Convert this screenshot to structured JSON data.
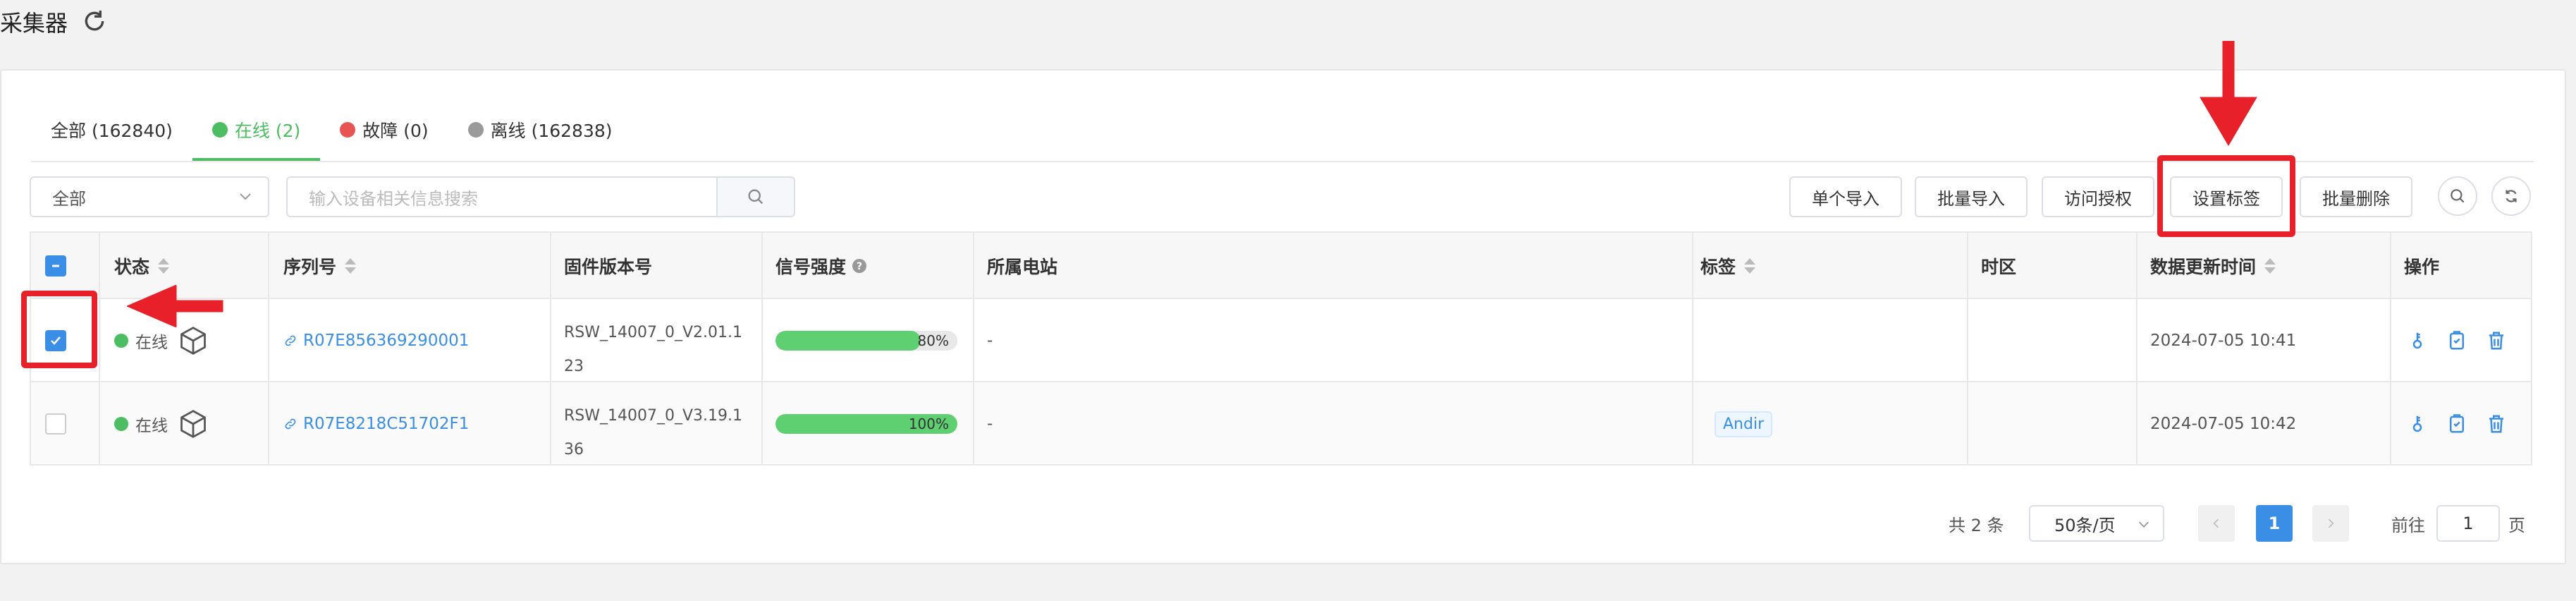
{
  "page": {
    "title": "采集器"
  },
  "tabs": [
    {
      "label": "全部 (162840)",
      "dot": null,
      "active": false
    },
    {
      "label": "在线 (2)",
      "dot": "#4cbd62",
      "active": true
    },
    {
      "label": "故障 (0)",
      "dot": "#e85454",
      "active": false
    },
    {
      "label": "离线 (162838)",
      "dot": "#9a9a9a",
      "active": false
    }
  ],
  "filter": {
    "select_value": "全部",
    "search_placeholder": "输入设备相关信息搜索"
  },
  "toolbar": {
    "single_import": "单个导入",
    "batch_import": "批量导入",
    "access_auth": "访问授权",
    "set_tags": "设置标签",
    "batch_delete": "批量删除"
  },
  "table": {
    "headers": {
      "status": "状态",
      "serial": "序列号",
      "firmware": "固件版本号",
      "signal": "信号强度",
      "station": "所属电站",
      "tags": "标签",
      "timezone": "时区",
      "updated": "数据更新时间",
      "actions": "操作"
    },
    "rows": [
      {
        "checked": true,
        "status": "在线",
        "serial": "R07E856369290001",
        "firmware_l1": "RSW_14007_0_V2.01.1",
        "firmware_l2": "23",
        "signal_pct": 80,
        "signal_label": "80%",
        "station": "-",
        "tag": "",
        "timezone": "",
        "updated": "2024-07-05 10:41"
      },
      {
        "checked": false,
        "status": "在线",
        "serial": "R07E8218C51702F1",
        "firmware_l1": "RSW_14007_0_V3.19.1",
        "firmware_l2": "36",
        "signal_pct": 100,
        "signal_label": "100%",
        "station": "-",
        "tag": "Andir",
        "timezone": "",
        "updated": "2024-07-05 10:42"
      }
    ]
  },
  "pagination": {
    "total": "共 2 条",
    "page_size": "50条/页",
    "current": "1",
    "goto_prefix": "前往",
    "goto_value": "1",
    "goto_suffix": "页"
  },
  "colors": {
    "accent": "#3a8ee6",
    "online": "#4cbd62",
    "annotation": "#e8202a"
  }
}
